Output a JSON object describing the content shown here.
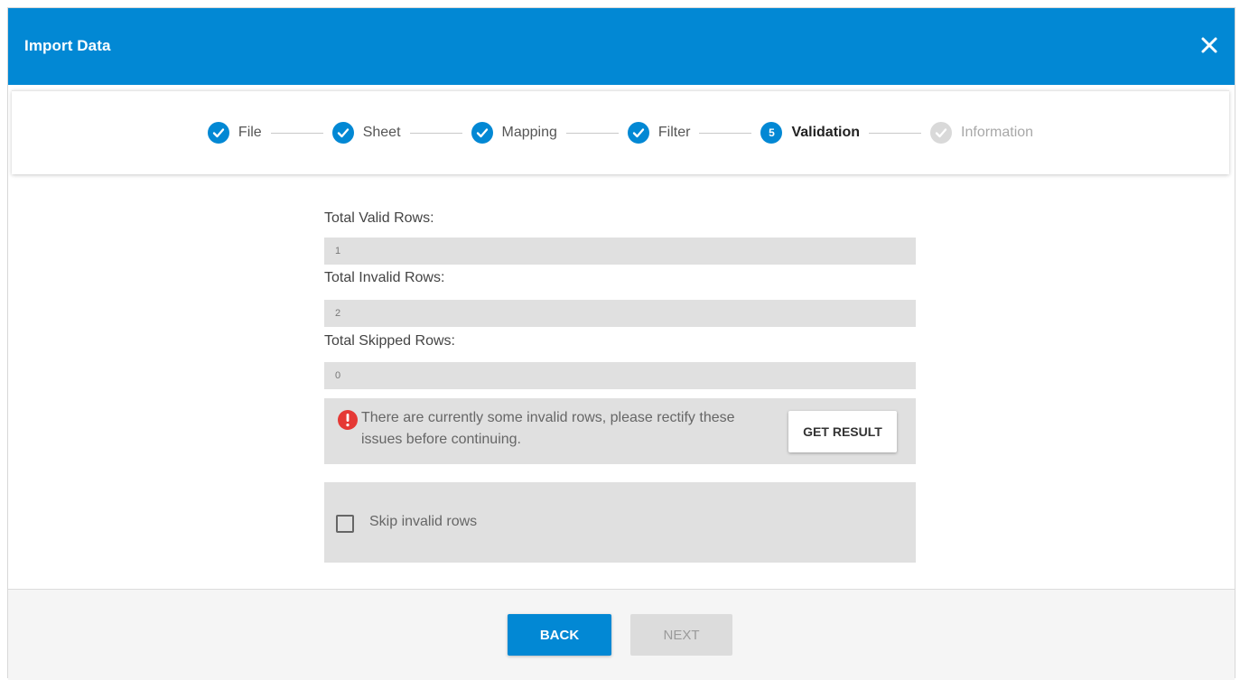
{
  "dialog": {
    "title": "Import Data"
  },
  "steps": [
    {
      "label": "File",
      "state": "done"
    },
    {
      "label": "Sheet",
      "state": "done"
    },
    {
      "label": "Mapping",
      "state": "done"
    },
    {
      "label": "Filter",
      "state": "done"
    },
    {
      "label": "Validation",
      "state": "active",
      "number": "5"
    },
    {
      "label": "Information",
      "state": "pending"
    }
  ],
  "fields": {
    "valid": {
      "label": "Total Valid Rows:",
      "value": "1"
    },
    "invalid": {
      "label": "Total Invalid Rows:",
      "value": "2"
    },
    "skipped": {
      "label": "Total Skipped Rows:",
      "value": "0"
    }
  },
  "warning": {
    "message": "There are currently some invalid rows, please rectify these issues before continuing.",
    "button": "GET RESULT",
    "icon": "error-icon"
  },
  "skip": {
    "label": "Skip invalid rows",
    "checked": false
  },
  "footer": {
    "back": "BACK",
    "next": "NEXT"
  },
  "colors": {
    "accent": "#0288d4",
    "error": "#e53935",
    "pending": "#d9d9d9"
  }
}
